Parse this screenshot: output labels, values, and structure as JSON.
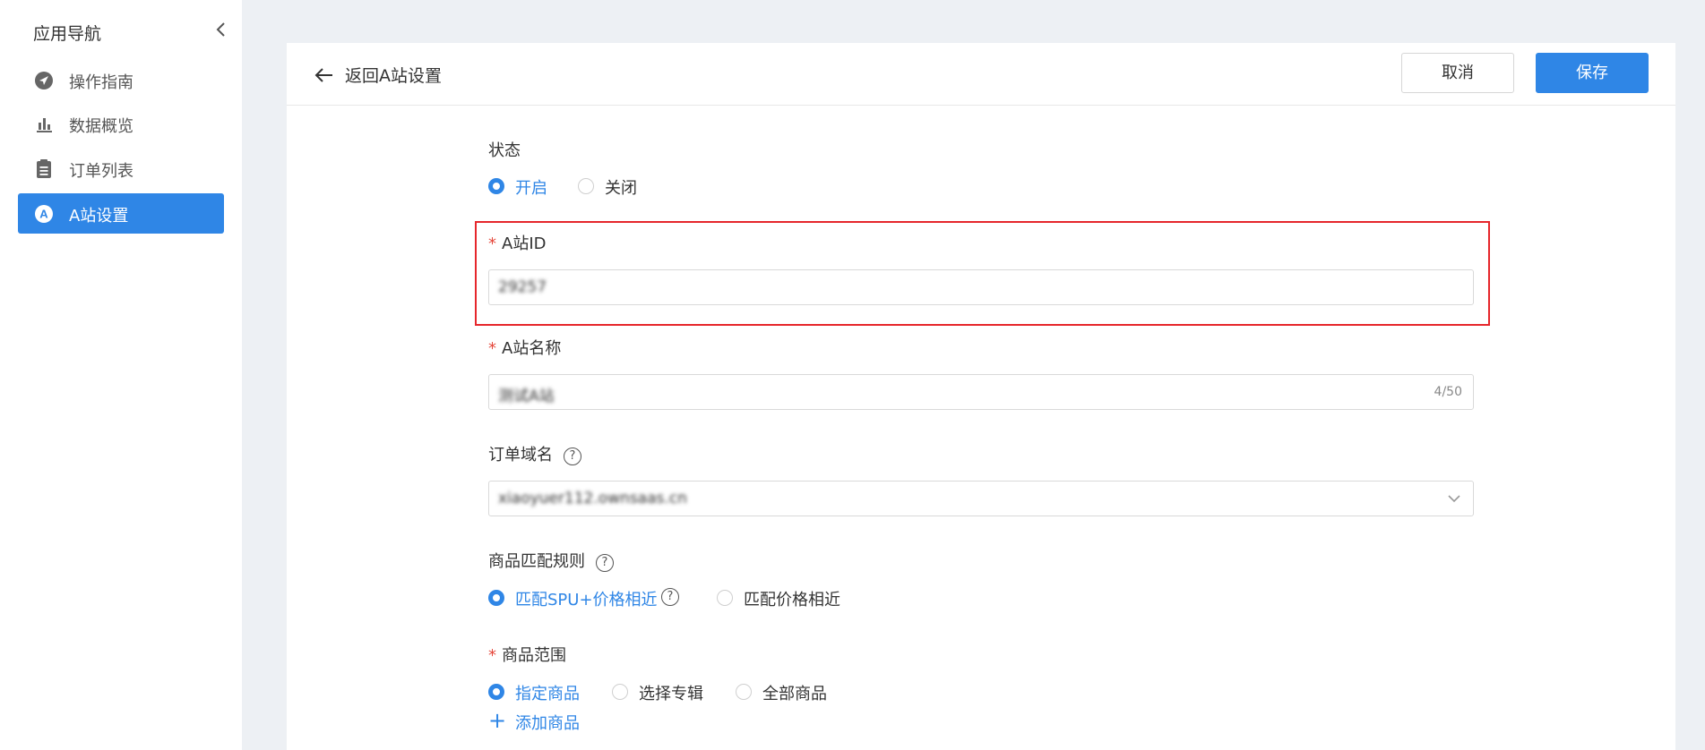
{
  "sidebar": {
    "title": "应用导航",
    "items": [
      {
        "label": "操作指南",
        "icon": "navigation-icon",
        "active": false
      },
      {
        "label": "数据概览",
        "icon": "bar-chart-icon",
        "active": false
      },
      {
        "label": "订单列表",
        "icon": "clipboard-icon",
        "active": false
      },
      {
        "label": "A站设置",
        "icon": "a-circle-icon",
        "active": true
      }
    ]
  },
  "header": {
    "back_label": "返回A站设置",
    "cancel_label": "取消",
    "save_label": "保存"
  },
  "form": {
    "status": {
      "label": "状态",
      "options": [
        "开启",
        "关闭"
      ],
      "selected": "开启"
    },
    "site_id": {
      "required_mark": "*",
      "label": "A站ID",
      "value": "29257"
    },
    "site_name": {
      "required_mark": "*",
      "label": "A站名称",
      "value": "测试A站",
      "counter": "4/50"
    },
    "order_domain": {
      "label": "订单域名",
      "help": "?",
      "value": "xiaoyuer112.ownsaas.cn"
    },
    "match_rule": {
      "label": "商品匹配规则",
      "help": "?",
      "options": [
        "匹配SPU+价格相近",
        "匹配价格相近"
      ],
      "selected": "匹配SPU+价格相近",
      "option_help": "?"
    },
    "product_scope": {
      "required_mark": "*",
      "label": "商品范围",
      "options": [
        "指定商品",
        "选择专辑",
        "全部商品"
      ],
      "selected": "指定商品",
      "add_label": "添加商品",
      "add_icon": "+"
    }
  },
  "colors": {
    "accent": "#2f86e6",
    "highlight": "#e6262b",
    "required": "#e5483c",
    "page_bg": "#edf0f4"
  }
}
